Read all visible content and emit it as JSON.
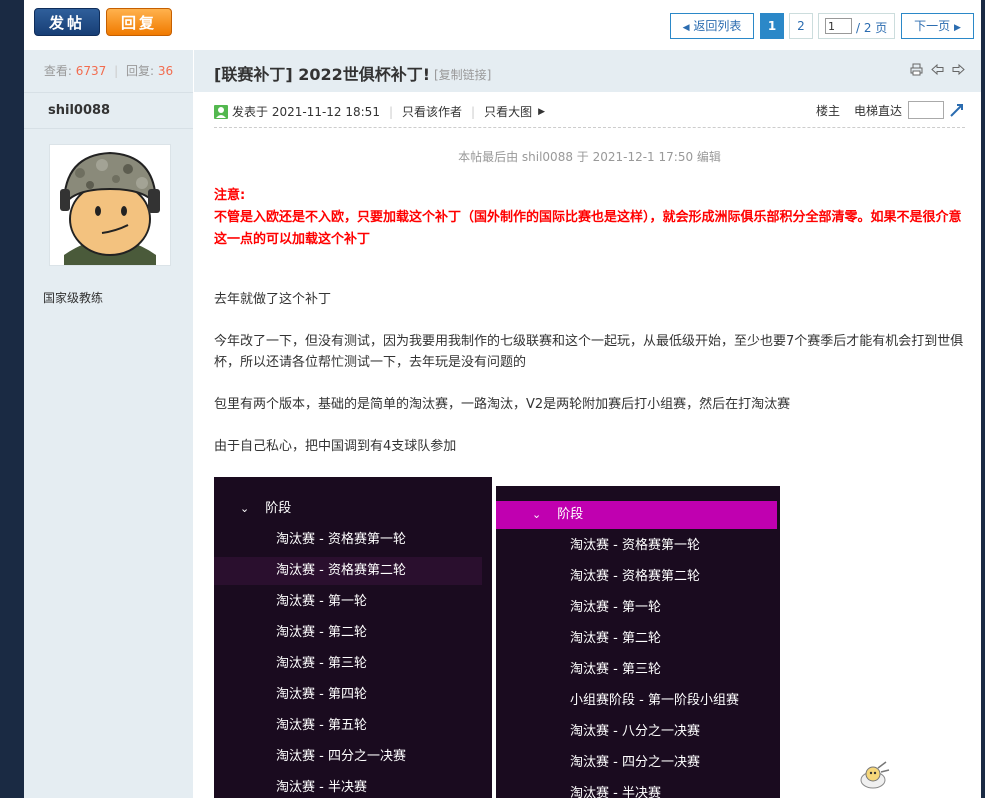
{
  "toolbar": {
    "post_label": "发帖",
    "reply_label": "回复"
  },
  "pagination": {
    "back_label": "返回列表",
    "pages": [
      "1",
      "2"
    ],
    "current_page": "1",
    "total_label": "/ 2 页",
    "next_label": "下一页"
  },
  "sidebar": {
    "views_label": "查看:",
    "views": "6737",
    "sep": "|",
    "replies_label": "回复:",
    "replies": "36",
    "username": "shil0088",
    "rank": "国家级教练"
  },
  "post": {
    "title": "[联赛补丁] 2022世俱杯补丁!",
    "copy_link": "[复制链接]",
    "posted_at": "发表于 2021-11-12 18:51",
    "only_author": "只看该作者",
    "only_large_images": "只看大图",
    "floor_label": "楼主",
    "elevator_label": "电梯直达",
    "edit_note": "本帖最后由 shil0088 于 2021-12-1 17:50 编辑",
    "notice_title": "注意:",
    "notice_body": "不管是入欧还是不入欧，只要加载这个补丁（国外制作的国际比赛也是这样），就会形成洲际俱乐部积分全部清零。如果不是很介意这一点的可以加载这个补丁",
    "paragraphs": [
      "去年就做了这个补丁",
      "今年改了一下，但没有测试，因为我要用我制作的七级联赛和这个一起玩，从最低级开始，至少也要7个赛季后才能有机会打到世俱杯，所以还请各位帮忙测试一下，去年玩是没有问题的",
      "包里有两个版本，基础的是简单的淘汰赛，一路淘汰，V2是两轮附加赛后打小组赛，然后在打淘汰赛",
      "由于自己私心，把中国调到有4支球队参加"
    ]
  },
  "shot_left": {
    "group_label": "阶段",
    "items": [
      "淘汰赛 - 资格赛第一轮",
      "淘汰赛 - 资格赛第二轮",
      "淘汰赛 - 第一轮",
      "淘汰赛 - 第二轮",
      "淘汰赛 - 第三轮",
      "淘汰赛 - 第四轮",
      "淘汰赛 - 第五轮",
      "淘汰赛 - 四分之一决赛",
      "淘汰赛 - 半决赛"
    ],
    "highlight_color": "#2a0f2e"
  },
  "shot_right": {
    "group_label": "阶段",
    "items": [
      "淘汰赛 - 资格赛第一轮",
      "淘汰赛 - 资格赛第二轮",
      "淘汰赛 - 第一轮",
      "淘汰赛 - 第二轮",
      "淘汰赛 - 第三轮",
      "小组赛阶段 - 第一阶段小组赛",
      "淘汰赛 - 八分之一决赛",
      "淘汰赛 - 四分之一决赛",
      "淘汰赛 - 半决赛"
    ],
    "highlight_color": "#c000b0"
  },
  "colors": {
    "accent_blue": "#2b88c8",
    "notice_red": "#ff0000",
    "stat_red": "#f26c4f",
    "sidebar_bg": "#e5edf2"
  },
  "icons": [
    "print-icon",
    "prev-thread-icon",
    "next-thread-icon",
    "online-status-icon",
    "elevator-go-icon",
    "chevron-down-icon"
  ]
}
